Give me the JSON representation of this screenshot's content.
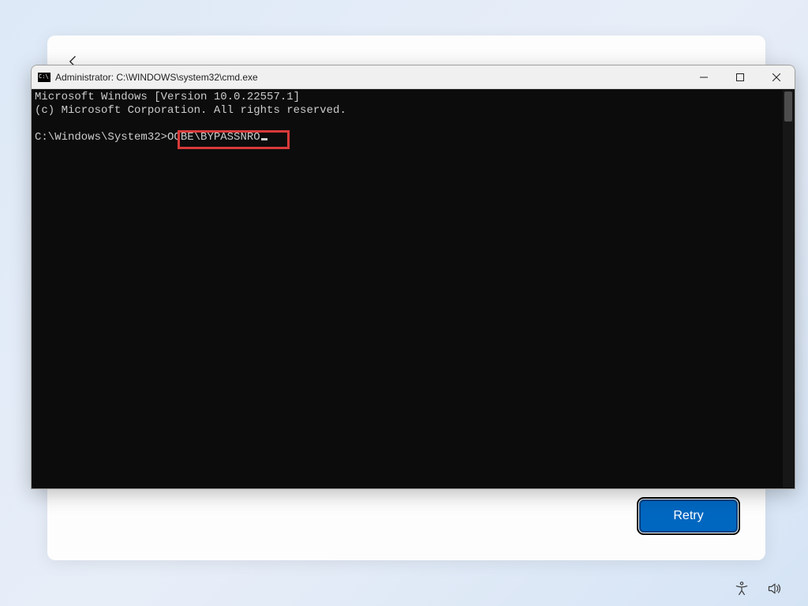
{
  "oobe": {
    "retry_label": "Retry"
  },
  "cmd": {
    "title": "Administrator: C:\\WINDOWS\\system32\\cmd.exe",
    "line1": "Microsoft Windows [Version 10.0.22557.1]",
    "line2": "(c) Microsoft Corporation. All rights reserved.",
    "prompt": "C:\\Windows\\System32>",
    "typed": "OOBE\\BYPASSNRO"
  },
  "icons": {
    "back": "back-arrow-icon",
    "cmd": "cmd-icon",
    "minimize": "minimize-icon",
    "maximize": "maximize-icon",
    "close": "close-icon",
    "accessibility": "accessibility-icon",
    "volume": "volume-icon"
  },
  "colors": {
    "accent": "#0067c0",
    "highlight_border": "#d93a3a",
    "terminal_bg": "#0c0c0c",
    "terminal_fg": "#cccccc"
  }
}
